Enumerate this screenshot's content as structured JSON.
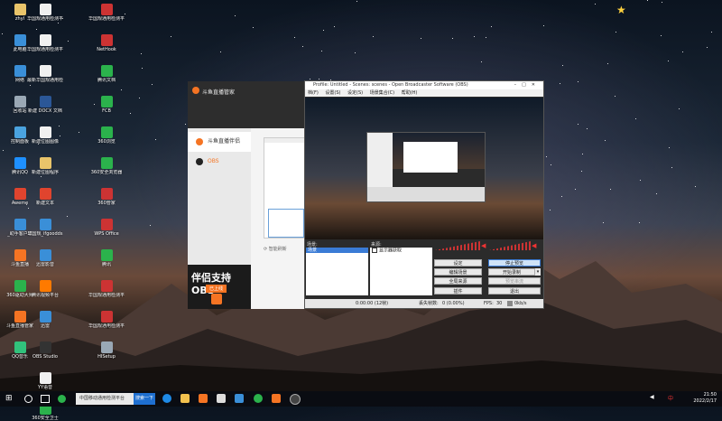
{
  "desktop": {
    "icons": [
      {
        "label": "zhyl",
        "color": "#e9c46a"
      },
      {
        "label": "此电脑",
        "color": "#3a8fd8"
      },
      {
        "label": "网络",
        "color": "#3a8fd8"
      },
      {
        "label": "回收站",
        "color": "#9aa8b5"
      },
      {
        "label": "控制面板",
        "color": "#4aa3df"
      },
      {
        "label": "腾讯QQ",
        "color": "#1e90ff"
      },
      {
        "label": "Aweme",
        "color": "#e0442e"
      },
      {
        "label": "_助手客户端",
        "color": "#3a8fd8"
      },
      {
        "label": "斗鱼直播",
        "color": "#f57423"
      },
      {
        "label": "360驱动大师",
        "color": "#2bb24c"
      },
      {
        "label": "斗鱼直播管家",
        "color": "#f57423"
      },
      {
        "label": "QQ音乐",
        "color": "#31c27c"
      },
      {
        "label": "华国规通用检测平台",
        "color": "#f0f0f0"
      },
      {
        "label": "华国规通用检测平台(ver5.0版",
        "color": "#f0f0f0"
      },
      {
        "label": "最新华国规通用检测平台(ver5.0版",
        "color": "#f0f0f0"
      },
      {
        "label": "新建 DOCX 文档",
        "color": "#2b5797"
      },
      {
        "label": "新建位图图像",
        "color": "#f0f0f0"
      },
      {
        "label": "新建位图程序",
        "color": "#e9c46a"
      },
      {
        "label": "新建文本",
        "color": "#e0442e"
      },
      {
        "label": "华国规_ifgoodds",
        "color": "#3a8fd8"
      },
      {
        "label": "迅雷影音",
        "color": "#3a8fd8"
      },
      {
        "label": "腾讯视频平台",
        "color": "#ff7a00"
      },
      {
        "label": "迅雷",
        "color": "#3a8fd8"
      },
      {
        "label": "OBS Studio",
        "color": "#333"
      },
      {
        "label": "YY语音",
        "color": "#f0f0f0"
      },
      {
        "label": "360安全卫士",
        "color": "#2bb24c"
      },
      {
        "label": "华国规通用检测平台",
        "color": "#cc3333"
      },
      {
        "label": "NetHook",
        "color": "#cc3333"
      },
      {
        "label": "腾讯文档",
        "color": "#2bb24c"
      },
      {
        "label": "FCB",
        "color": "#2bb24c"
      },
      {
        "label": "360浏览",
        "color": "#2bb24c"
      },
      {
        "label": "360安全浏览器",
        "color": "#2bb24c"
      },
      {
        "label": "360管家",
        "color": "#cc3333"
      },
      {
        "label": "WPS Office",
        "color": "#cc3333"
      },
      {
        "label": "腾讯",
        "color": "#2bb24c"
      },
      {
        "label": "华国规通用检测平台",
        "color": "#cc3333"
      },
      {
        "label": "华国规通用检测平台",
        "color": "#cc3333"
      },
      {
        "label": "HISetup",
        "color": "#9aa8b5"
      }
    ]
  },
  "douyu": {
    "title": "斗鱼直播管家",
    "menu": [
      {
        "label": "斗鱼直播伴侣",
        "color": "#f57423"
      },
      {
        "label": "OBS",
        "color": "#222"
      }
    ],
    "banner_line1": "伴侣支持OBS",
    "banner_line2": "已上线",
    "refresh_label": "智能刷新"
  },
  "obs": {
    "title": "Profile: Untitled - Scenes: scenes - Open Broadcaster Software (OBS)",
    "menu": [
      "档(F)",
      "设置(S)",
      "设定(S)",
      "场景集合(C)",
      "帮助(H)"
    ],
    "scenes_label": "场景:",
    "sources_label": "来源:",
    "scene_item": "场景",
    "source_item": "显示器获取",
    "buttons": {
      "settings": "设定",
      "stop_preview": "停止预览",
      "edit_scene": "编辑场景",
      "start_record": "开始录制",
      "global_source": "全局来源",
      "preview_stream": "预览串流",
      "plugins": "插件",
      "exit": "退出"
    },
    "status": {
      "time": "0:00:00 (12帧)",
      "dropped_label": "丢失帧数:",
      "dropped_value": "0 (0.00%)",
      "fps_label": "FPS:",
      "fps_value": "30",
      "kbps": "0kb/s"
    }
  },
  "taskbar": {
    "search_text": "中国移动通用检测平台",
    "search_button": "搜索一下",
    "time": "21:50",
    "date": "2022/2/17",
    "ime": "中"
  }
}
